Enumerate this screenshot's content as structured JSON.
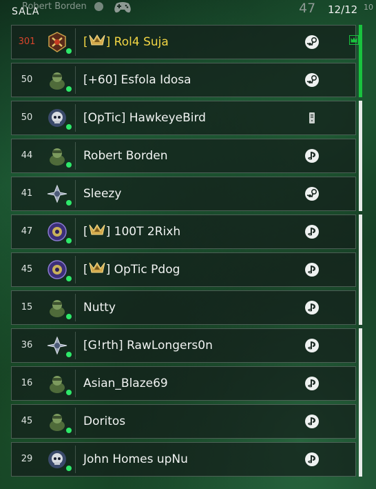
{
  "header": {
    "title": "SALA",
    "username": "Robert Borden",
    "level": "47",
    "player_count": "12/12",
    "corner_text": "10"
  },
  "colors": {
    "party_green": "#19c33e",
    "party_white": "#e7ece9",
    "online": "#2ee86a",
    "prestige_rank": "#d8452b",
    "highlight_name": "#f2d544"
  },
  "players": [
    {
      "rank": "301",
      "clan_badge": true,
      "prefix": "[",
      "suffix": "] Rol4 Suja",
      "platform": "steam",
      "prestige": true,
      "highlight": true,
      "party_leader": true,
      "emblem": "prestige-emblem"
    },
    {
      "rank": "50",
      "clan_badge": false,
      "prefix": "",
      "suffix": "[+60] Esfola Idosa",
      "platform": "steam",
      "prestige": false,
      "highlight": false,
      "party_leader": false,
      "emblem": "soldier-emblem"
    },
    {
      "rank": "50",
      "clan_badge": false,
      "prefix": "",
      "suffix": "[OpTic] HawkeyeBird",
      "platform": "battlenet",
      "prestige": false,
      "highlight": false,
      "party_leader": false,
      "emblem": "skull-emblem"
    },
    {
      "rank": "44",
      "clan_badge": false,
      "prefix": "",
      "suffix": "Robert Borden",
      "platform": "playstation",
      "prestige": false,
      "highlight": false,
      "party_leader": false,
      "emblem": "soldier-emblem"
    },
    {
      "rank": "41",
      "clan_badge": false,
      "prefix": "",
      "suffix": "Sleezy",
      "platform": "steam",
      "prestige": false,
      "highlight": false,
      "party_leader": false,
      "emblem": "winged-emblem"
    },
    {
      "rank": "47",
      "clan_badge": true,
      "prefix": "[",
      "suffix": "] 100T 2Rixh",
      "platform": "playstation",
      "prestige": false,
      "highlight": false,
      "party_leader": false,
      "emblem": "orb-emblem"
    },
    {
      "rank": "45",
      "clan_badge": true,
      "prefix": "[",
      "suffix": "] OpTic Pdog",
      "platform": "playstation",
      "prestige": false,
      "highlight": false,
      "party_leader": false,
      "emblem": "orb-emblem"
    },
    {
      "rank": "15",
      "clan_badge": false,
      "prefix": "",
      "suffix": "Nutty",
      "platform": "playstation",
      "prestige": false,
      "highlight": false,
      "party_leader": false,
      "emblem": "soldier-emblem"
    },
    {
      "rank": "36",
      "clan_badge": false,
      "prefix": "",
      "suffix": "[G!rth] RawLongers0n",
      "platform": "playstation",
      "prestige": false,
      "highlight": false,
      "party_leader": false,
      "emblem": "winged-emblem"
    },
    {
      "rank": "16",
      "clan_badge": false,
      "prefix": "",
      "suffix": "Asian_Blaze69",
      "platform": "playstation",
      "prestige": false,
      "highlight": false,
      "party_leader": false,
      "emblem": "soldier-emblem"
    },
    {
      "rank": "45",
      "clan_badge": false,
      "prefix": "",
      "suffix": "Doritos",
      "platform": "playstation",
      "prestige": false,
      "highlight": false,
      "party_leader": false,
      "emblem": "soldier-emblem"
    },
    {
      "rank": "29",
      "clan_badge": false,
      "prefix": "",
      "suffix": "John Homes upNu",
      "platform": "playstation",
      "prestige": false,
      "highlight": false,
      "party_leader": false,
      "emblem": "skull-emblem"
    }
  ],
  "parties": [
    {
      "color": "#19c33e",
      "members": 2
    },
    {
      "color": "#e7ece9",
      "members": 3
    },
    {
      "color": "#e7ece9",
      "members": 3
    },
    {
      "color": "#e7ece9",
      "members": 4
    }
  ]
}
